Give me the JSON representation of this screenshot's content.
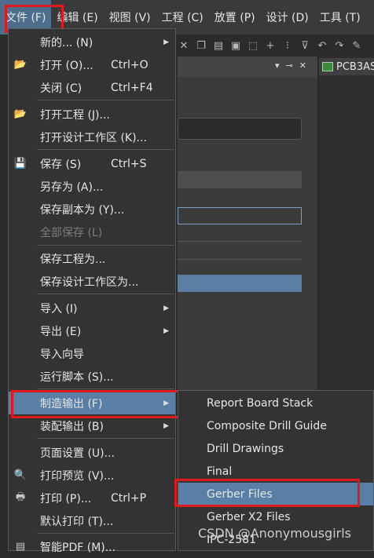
{
  "menubar": {
    "items": [
      {
        "label": "文件 (F)"
      },
      {
        "label": "编辑 (E)"
      },
      {
        "label": "视图 (V)"
      },
      {
        "label": "工程 (C)"
      },
      {
        "label": "放置 (P)"
      },
      {
        "label": "设计 (D)"
      },
      {
        "label": "工具 (T)"
      }
    ]
  },
  "doc_tab": {
    "label": "PCB3AS"
  },
  "file_menu": {
    "items": [
      {
        "label": "新的... (N)",
        "shortcut": ""
      },
      {
        "label": "打开 (O)...",
        "shortcut": "Ctrl+O"
      },
      {
        "label": "关闭 (C)",
        "shortcut": "Ctrl+F4"
      },
      {
        "label": "打开工程 (J)...",
        "shortcut": ""
      },
      {
        "label": "打开设计工作区 (K)...",
        "shortcut": ""
      },
      {
        "label": "保存 (S)",
        "shortcut": "Ctrl+S"
      },
      {
        "label": "另存为 (A)...",
        "shortcut": ""
      },
      {
        "label": "保存副本为 (Y)...",
        "shortcut": ""
      },
      {
        "label": "全部保存 (L)",
        "shortcut": ""
      },
      {
        "label": "保存工程为...",
        "shortcut": ""
      },
      {
        "label": "保存设计工作区为...",
        "shortcut": ""
      },
      {
        "label": "导入 (I)",
        "shortcut": ""
      },
      {
        "label": "导出 (E)",
        "shortcut": ""
      },
      {
        "label": "导入向导",
        "shortcut": ""
      },
      {
        "label": "运行脚本 (S)...",
        "shortcut": ""
      },
      {
        "label": "制造输出 (F)",
        "shortcut": ""
      },
      {
        "label": "装配输出 (B)",
        "shortcut": ""
      },
      {
        "label": "页面设置 (U)...",
        "shortcut": ""
      },
      {
        "label": "打印预览 (V)...",
        "shortcut": ""
      },
      {
        "label": "打印 (P)...",
        "shortcut": "Ctrl+P"
      },
      {
        "label": "默认打印 (T)...",
        "shortcut": ""
      },
      {
        "label": "智能PDF (M)...",
        "shortcut": ""
      }
    ]
  },
  "fab_submenu": {
    "items": [
      {
        "label": "Report Board Stack"
      },
      {
        "label": "Composite Drill Guide"
      },
      {
        "label": "Drill Drawings"
      },
      {
        "label": "Final"
      },
      {
        "label": "Gerber Files"
      },
      {
        "label": "Gerber X2 Files"
      },
      {
        "label": "IPC-2581"
      }
    ]
  },
  "watermark": {
    "text": "CSDN @Anonymousgirls"
  },
  "colors": {
    "highlight": "#5a7fa6",
    "annotation_red": "#e0191f"
  }
}
